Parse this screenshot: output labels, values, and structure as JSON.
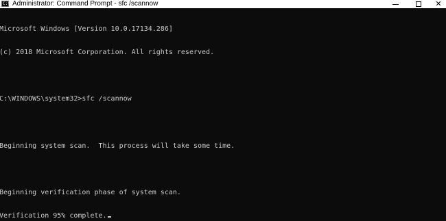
{
  "window": {
    "title": "Administrator: Command Prompt - sfc  /scannow",
    "icon": "cmd-icon",
    "icon_glyph": "C:\\",
    "buttons": {
      "minimize": "minimize-icon",
      "maximize": "maximize-icon",
      "close_glyph": "✕"
    }
  },
  "console": {
    "lines": [
      "Microsoft Windows [Version 10.0.17134.286]",
      "(c) 2018 Microsoft Corporation. All rights reserved.",
      "",
      "C:\\WINDOWS\\system32>sfc /scannow",
      "",
      "Beginning system scan.  This process will take some time.",
      "",
      "Beginning verification phase of system scan.",
      "Verification 95% complete."
    ],
    "colors": {
      "background": "#0c0c0c",
      "text": "#cccccc"
    }
  }
}
